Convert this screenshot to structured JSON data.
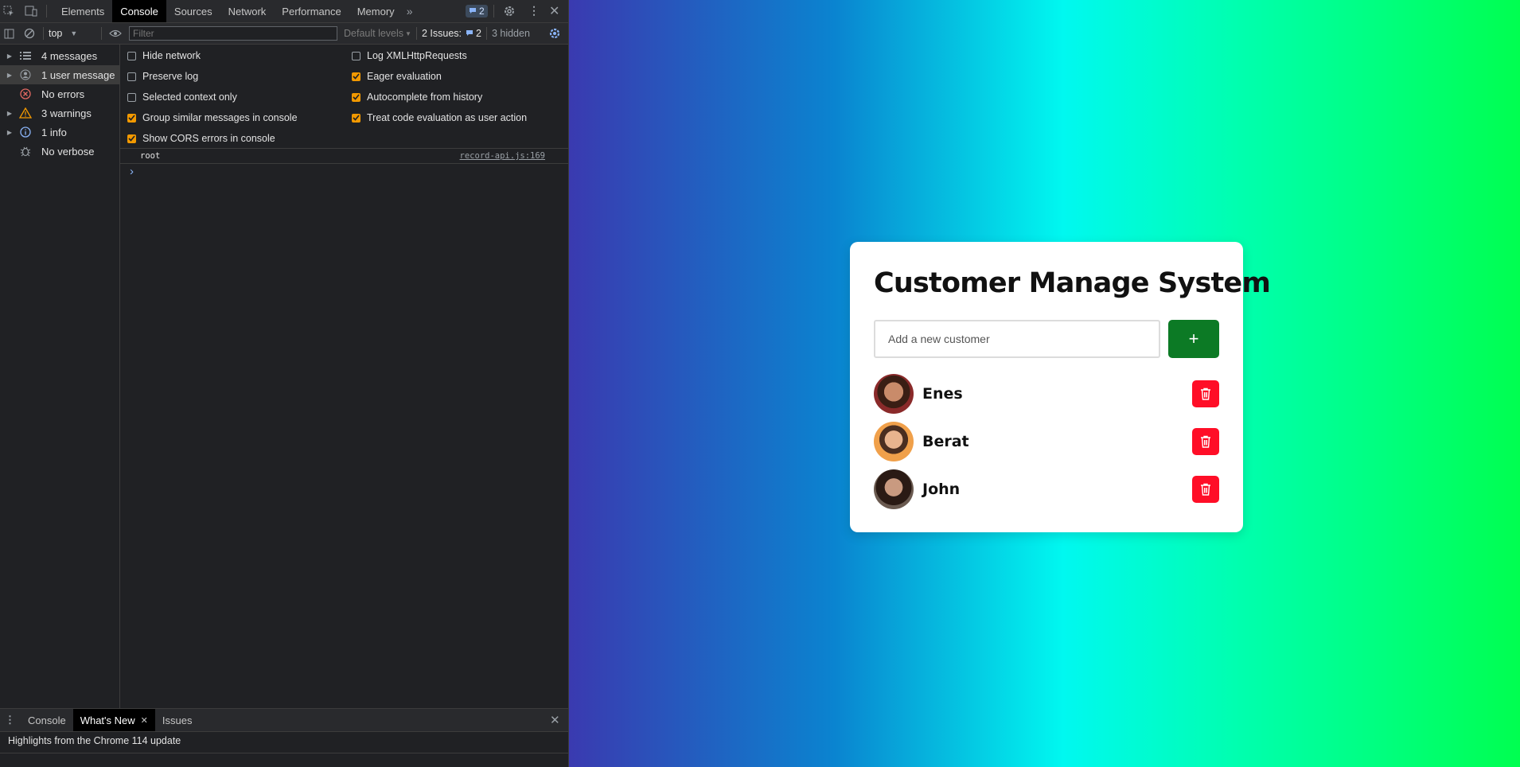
{
  "devtools": {
    "tabs": [
      "Elements",
      "Console",
      "Sources",
      "Network",
      "Performance",
      "Memory"
    ],
    "active_tab": "Console",
    "issues_badge_count": "2",
    "console_toolbar": {
      "context": "top",
      "filter_placeholder": "Filter",
      "levels": "Default levels",
      "issues_label": "2 Issues:",
      "issues_count": "2",
      "hidden_label": "3 hidden"
    },
    "sidebar": [
      {
        "label": "4 messages",
        "icon": "list-icon"
      },
      {
        "label": "1 user message",
        "icon": "user-icon"
      },
      {
        "label": "No errors",
        "icon": "error-icon"
      },
      {
        "label": "3 warnings",
        "icon": "warning-icon"
      },
      {
        "label": "1 info",
        "icon": "info-icon"
      },
      {
        "label": "No verbose",
        "icon": "bug-icon"
      }
    ],
    "settings": [
      {
        "label": "Hide network",
        "checked": false
      },
      {
        "label": "Preserve log",
        "checked": false
      },
      {
        "label": "Selected context only",
        "checked": false
      },
      {
        "label": "Group similar messages in console",
        "checked": true
      },
      {
        "label": "Show CORS errors in console",
        "checked": true
      },
      {
        "label": "Log XMLHttpRequests",
        "checked": false
      },
      {
        "label": "Eager evaluation",
        "checked": true
      },
      {
        "label": "Autocomplete from history",
        "checked": true
      },
      {
        "label": "Treat code evaluation as user action",
        "checked": true
      }
    ],
    "log": {
      "message": "root",
      "source": "record-api.js:169"
    },
    "prompt": "›",
    "drawer": {
      "tabs": [
        "Console",
        "What's New",
        "Issues"
      ],
      "active": "What's New",
      "content": "Highlights from the Chrome 114 update"
    }
  },
  "app": {
    "title": "Customer Manage System",
    "input_placeholder": "Add a new customer",
    "add_label": "+",
    "customers": [
      "Enes",
      "Berat",
      "John"
    ]
  }
}
